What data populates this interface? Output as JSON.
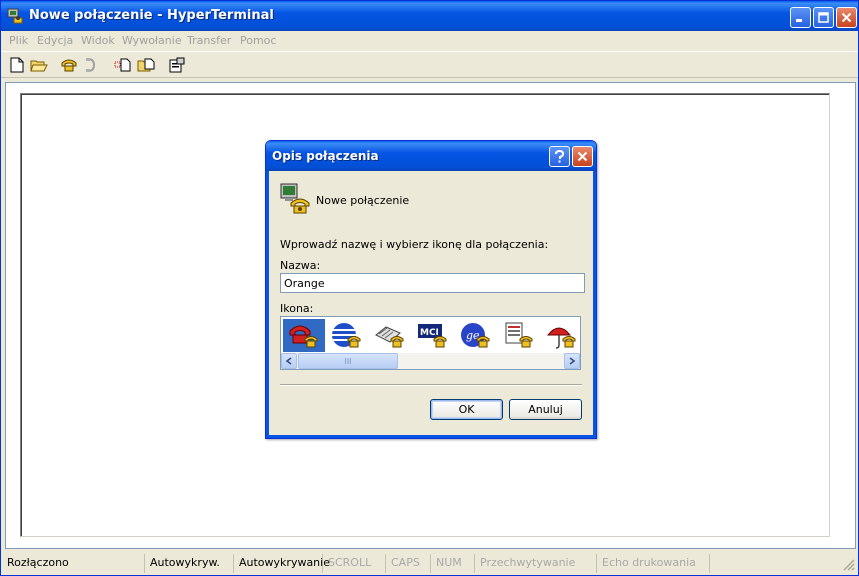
{
  "window": {
    "title": "Nowe połączenie - HyperTerminal",
    "app_icon": "hyperterminal-icon",
    "controls": [
      "minimize-icon",
      "maximize-icon",
      "close-icon"
    ]
  },
  "menubar": {
    "items": [
      "Plik",
      "Edycja",
      "Widok",
      "Wywołanie",
      "Transfer",
      "Pomoc"
    ]
  },
  "toolbar": {
    "icons": [
      "new-document-icon",
      "open-folder-icon",
      "phone-connect-icon",
      "disconnect-icon",
      "send-file-icon",
      "receive-file-icon",
      "properties-icon"
    ]
  },
  "statusbar": {
    "cells": [
      "Rozłączono",
      "Autowykryw.",
      "Autowykrywanie",
      "SCROLL",
      "CAPS",
      "NUM",
      "Przechwytywanie",
      "Echo drukowania"
    ]
  },
  "dialog": {
    "title": "Opis połączenia",
    "connection_name": "Nowe połączenie",
    "instruction": "Wprowadź nazwę i wybierz ikonę dla połączenia:",
    "name_label": "Nazwa:",
    "name_value": "Orange",
    "icon_label": "Ikona:",
    "scroll_thumb": "III",
    "icons": [
      "red-phone-icon",
      "globe-icon",
      "fax-icon",
      "mci-icon",
      "ge-logo-icon",
      "document-phone-icon",
      "umbrella-icon"
    ],
    "ok_label": "OK",
    "cancel_label": "Anuluj"
  },
  "colors": {
    "title_blue": "#0554e3",
    "selection": "#316ac5",
    "face": "#ece9d8"
  }
}
